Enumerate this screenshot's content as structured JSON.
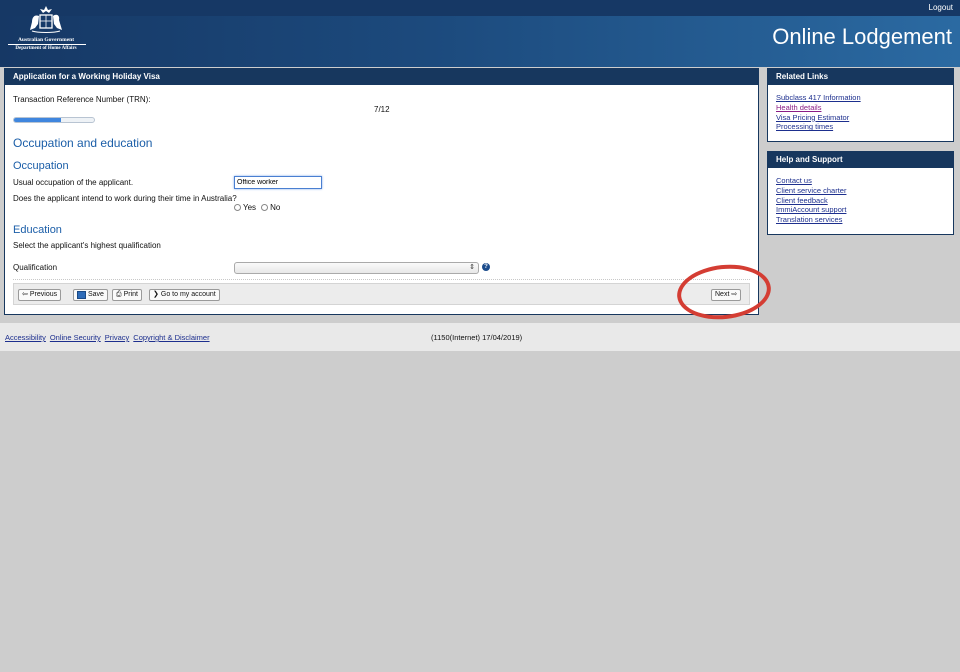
{
  "header": {
    "logout_label": "Logout",
    "app_title": "Online Lodgement",
    "gov_line1": "Australian Government",
    "gov_line2": "Department of Home Affairs"
  },
  "form": {
    "panel_title": "Application for a Working Holiday Visa",
    "trn_label": "Transaction Reference Number (TRN):",
    "page_counter": "7/12",
    "progress_fraction": 0.583,
    "section_title": "Occupation and education",
    "occupation": {
      "heading": "Occupation",
      "usual_label": "Usual occupation of the applicant.",
      "usual_value": "Office worker",
      "work_question": "Does the applicant intend to work during their time in Australia?",
      "yes_label": "Yes",
      "no_label": "No"
    },
    "education": {
      "heading": "Education",
      "instruction": "Select the applicant's highest qualification",
      "qualification_label": "Qualification",
      "qualification_value": ""
    },
    "buttons": {
      "previous": "Previous",
      "save": "Save",
      "print": "Print",
      "account": "Go to my account",
      "next": "Next"
    }
  },
  "sidebar": {
    "related_title": "Related Links",
    "related_links": [
      "Subclass 417 Information",
      "Health details",
      "Visa Pricing Estimator",
      "Processing times"
    ],
    "help_title": "Help and Support",
    "help_links": [
      "Contact us",
      "Client service charter",
      "Client feedback",
      "ImmiAccount support",
      "Translation services"
    ]
  },
  "footer": {
    "links": [
      "Accessibility",
      "Online Security",
      "Privacy",
      "Copyright & Disclaimer"
    ],
    "build_info": "(1150(Internet) 17/04/2019)"
  },
  "colors": {
    "header": "#163865",
    "accent_text": "#1b5ea8",
    "annotation": "#d43d33"
  }
}
